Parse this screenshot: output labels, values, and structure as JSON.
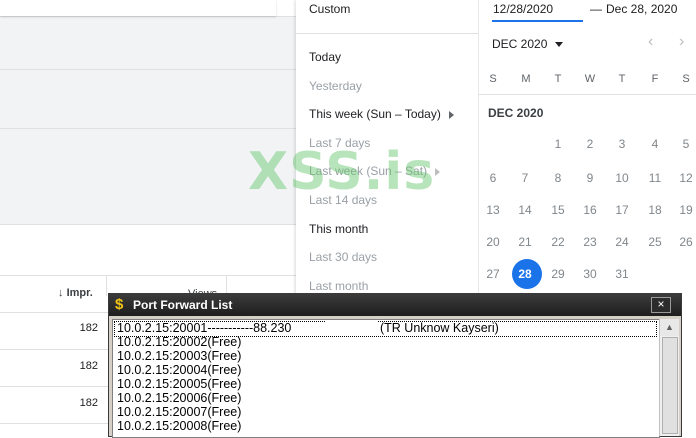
{
  "table": {
    "impr_header": "Impr.",
    "views_header": "Views",
    "rows": [
      "182",
      "182",
      "182"
    ]
  },
  "menu": {
    "custom": "Custom",
    "today": "Today",
    "yesterday": "Yesterday",
    "this_week": "This week (Sun – Today)",
    "last_7": "Last 7 days",
    "last_week": "Last week (Sun – Sat)",
    "last_14": "Last 14 days",
    "this_month": "This month",
    "last_30": "Last 30 days",
    "last_month": "Last month"
  },
  "calendar": {
    "start_date": "12/28/2020",
    "dash": "—",
    "end_date": "Dec 28, 2020",
    "month_select": "DEC 2020",
    "weekdays": [
      "S",
      "M",
      "T",
      "W",
      "T",
      "F",
      "S"
    ],
    "month_label": "DEC 2020",
    "days": [
      "1",
      "2",
      "3",
      "4",
      "5",
      "6",
      "7",
      "8",
      "9",
      "10",
      "11",
      "12",
      "13",
      "14",
      "15",
      "16",
      "17",
      "18",
      "19",
      "20",
      "21",
      "22",
      "23",
      "24",
      "25",
      "26",
      "27",
      "28",
      "29",
      "30",
      "31"
    ],
    "selected": "28"
  },
  "watermark": "XSS.is",
  "port_window": {
    "title": "Port Forward List",
    "close": "×",
    "rows": [
      "10.0.2.15:20001-----------88.230",
      "10.0.2.15:20002(Free)",
      "10.0.2.15:20003(Free)",
      "10.0.2.15:20004(Free)",
      "10.0.2.15:20005(Free)",
      "10.0.2.15:20006(Free)",
      "10.0.2.15:20007(Free)",
      "10.0.2.15:20008(Free)"
    ],
    "first_row_suffix": "(TR Unknow Kayseri)"
  },
  "colors": {
    "accent": "#1a73e8",
    "watermark": "#63c56b",
    "titlebar": "#2a2a2a"
  }
}
